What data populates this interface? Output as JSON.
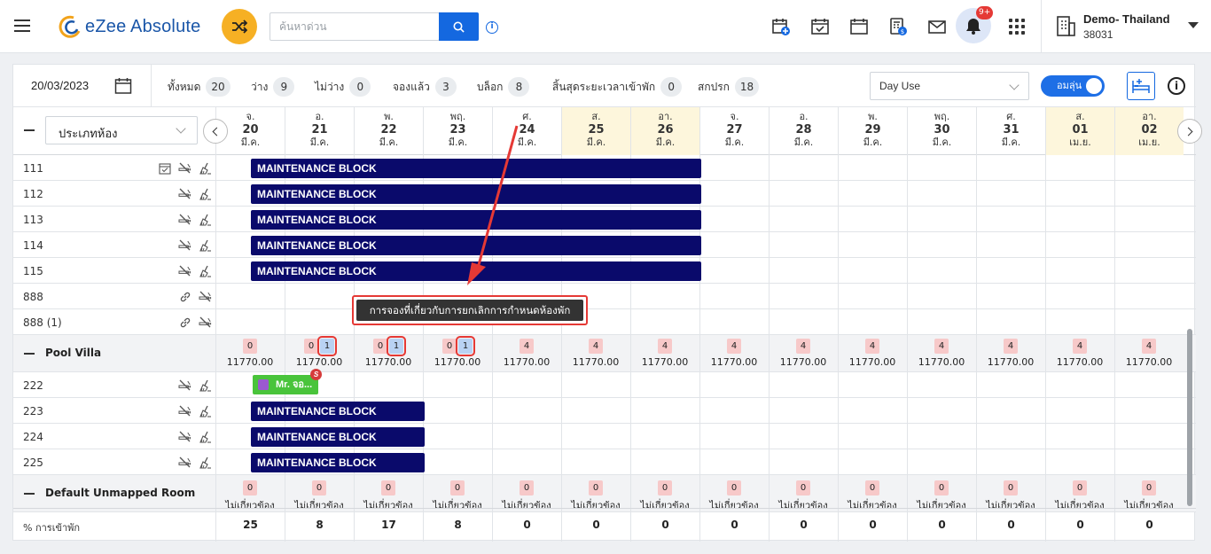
{
  "app": {
    "title": "eZee Absolute"
  },
  "search": {
    "placeholder": "ค้นหาด่วน"
  },
  "notifications": {
    "count": "9+"
  },
  "hotel": {
    "name": "Demo- Thailand",
    "id": "38031"
  },
  "stats": {
    "date": "20/03/2023",
    "items": [
      {
        "label": "ทั้งหมด",
        "value": "20"
      },
      {
        "label": "ว่าง",
        "value": "9"
      },
      {
        "label": "ไม่ว่าง",
        "value": "0"
      },
      {
        "label": "จองแล้ว",
        "value": "3"
      },
      {
        "label": "บล็อก",
        "value": "8"
      },
      {
        "label": "สิ้นสุดระยะเวลาเข้าพัก",
        "value": "0"
      },
      {
        "label": "สกปรก",
        "value": "18"
      }
    ],
    "view_select": "Day Use",
    "toggle_label": "อมลุ่น"
  },
  "grid": {
    "room_type_select": "ประเภทห้อง",
    "dates": [
      {
        "dow": "จ.",
        "day": "20",
        "mon": "มี.ค.",
        "weekend": false
      },
      {
        "dow": "อ.",
        "day": "21",
        "mon": "มี.ค.",
        "weekend": false
      },
      {
        "dow": "พ.",
        "day": "22",
        "mon": "มี.ค.",
        "weekend": false
      },
      {
        "dow": "พฤ.",
        "day": "23",
        "mon": "มี.ค.",
        "weekend": false
      },
      {
        "dow": "ศ.",
        "day": "24",
        "mon": "มี.ค.",
        "weekend": false
      },
      {
        "dow": "ส.",
        "day": "25",
        "mon": "มี.ค.",
        "weekend": true
      },
      {
        "dow": "อา.",
        "day": "26",
        "mon": "มี.ค.",
        "weekend": true
      },
      {
        "dow": "จ.",
        "day": "27",
        "mon": "มี.ค.",
        "weekend": false
      },
      {
        "dow": "อ.",
        "day": "28",
        "mon": "มี.ค.",
        "weekend": false
      },
      {
        "dow": "พ.",
        "day": "29",
        "mon": "มี.ค.",
        "weekend": false
      },
      {
        "dow": "พฤ.",
        "day": "30",
        "mon": "มี.ค.",
        "weekend": false
      },
      {
        "dow": "ศ.",
        "day": "31",
        "mon": "มี.ค.",
        "weekend": false
      },
      {
        "dow": "ส.",
        "day": "01",
        "mon": "เม.ย.",
        "weekend": true
      },
      {
        "dow": "อา.",
        "day": "02",
        "mon": "เม.ย.",
        "weekend": true
      }
    ],
    "block_label": "MAINTENANCE BLOCK",
    "rooms_top": [
      {
        "name": "111",
        "block_days": 7,
        "check": true,
        "link": false
      },
      {
        "name": "112",
        "block_days": 7,
        "check": false,
        "link": false
      },
      {
        "name": "113",
        "block_days": 7,
        "check": false,
        "link": false
      },
      {
        "name": "114",
        "block_days": 7,
        "check": false,
        "link": false
      },
      {
        "name": "115",
        "block_days": 7,
        "check": false,
        "link": false
      },
      {
        "name": "888",
        "block_days": 0,
        "check": false,
        "link": true
      },
      {
        "name": "888 (1)",
        "block_days": 0,
        "check": false,
        "link": true
      }
    ],
    "pool_villa": {
      "name": "Pool Villa",
      "avail": [
        {
          "n": "0",
          "b": ""
        },
        {
          "n": "0",
          "b": "1"
        },
        {
          "n": "0",
          "b": "1"
        },
        {
          "n": "0",
          "b": "1"
        },
        {
          "n": "4",
          "b": ""
        },
        {
          "n": "4",
          "b": ""
        },
        {
          "n": "4",
          "b": ""
        },
        {
          "n": "4",
          "b": ""
        },
        {
          "n": "4",
          "b": ""
        },
        {
          "n": "4",
          "b": ""
        },
        {
          "n": "4",
          "b": ""
        },
        {
          "n": "4",
          "b": ""
        },
        {
          "n": "4",
          "b": ""
        },
        {
          "n": "4",
          "b": ""
        }
      ],
      "price": "11770.00"
    },
    "booking": {
      "guest": "Mr. จอ...",
      "badge": "S"
    },
    "rooms_pool": [
      {
        "name": "222",
        "block_days": 0
      },
      {
        "name": "223",
        "block_days": 3
      },
      {
        "name": "224",
        "block_days": 3
      },
      {
        "name": "225",
        "block_days": 3
      }
    ],
    "unmapped": {
      "name": "Default Unmapped Room",
      "value": "0",
      "label": "ไม่เกี่ยวข้อง"
    },
    "occupancy": {
      "label": "% การเข้าพัก",
      "values": [
        "25",
        "8",
        "17",
        "8",
        "0",
        "0",
        "0",
        "0",
        "0",
        "0",
        "0",
        "0",
        "0",
        "0"
      ]
    }
  },
  "tooltip": {
    "text": "การจองที่เกี่ยวกับการยกเลิกการกำหนดห้องพัก"
  },
  "colors": {
    "primary": "#1468e0",
    "block": "#0a0a6b",
    "booking": "#49c43b",
    "annotation": "#e53935"
  }
}
